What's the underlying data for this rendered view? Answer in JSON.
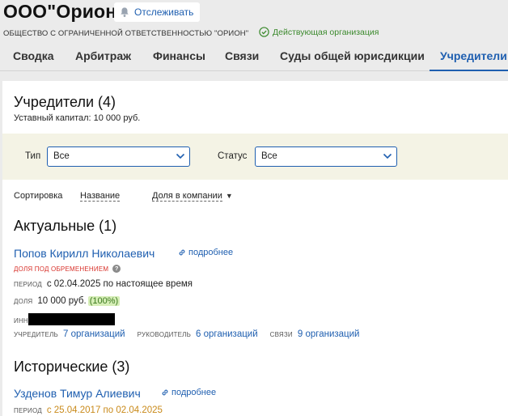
{
  "company": {
    "name": "ООО\"Орион\"",
    "watch_label": "Отслеживать",
    "full_name": "ОБЩЕСТВО С ОГРАНИЧЕННОЙ ОТВЕТСТВЕННОСТЬЮ \"ОРИОН\"",
    "status": "Действующая организация"
  },
  "tabs": [
    {
      "label": "Сводка",
      "active": false
    },
    {
      "label": "Арбитраж",
      "active": false
    },
    {
      "label": "Финансы",
      "active": false
    },
    {
      "label": "Связи",
      "active": false
    },
    {
      "label": "Суды общей юрисдикции",
      "active": false
    },
    {
      "label": "Учредители",
      "active": true
    }
  ],
  "founders": {
    "title": "Учредители (4)",
    "capital": "Уставный капитал: 10 000 руб.",
    "filters": {
      "type_label": "Тип",
      "type_value": "Все",
      "status_label": "Статус",
      "status_value": "Все"
    },
    "sort": {
      "label": "Сортировка",
      "by_name": "Название",
      "by_share": "Доля в компании"
    },
    "current": {
      "title": "Актуальные (1)",
      "person": {
        "name": "Попов Кирилл Николаевич",
        "more": "подробнее",
        "encumbrance": "ДОЛЯ ПОД ОБРЕМЕНЕНИЕМ",
        "period_label": "ПЕРИОД",
        "period": "с 02.04.2025 по настоящее время",
        "share_label": "ДОЛЯ",
        "share": "10 000 руб.",
        "share_pct": "(100%)",
        "inn_label": "ИНН",
        "founder_label": "УЧРЕДИТЕЛЬ",
        "founder_link": "7 организаций",
        "head_label": "РУКОВОДИТЕЛЬ",
        "head_link": "6 организаций",
        "ties_label": "СВЯЗИ",
        "ties_link": "9 организаций"
      }
    },
    "historic": {
      "title": "Исторические (3)",
      "person": {
        "name": "Узденов Тимур Алиевич",
        "more": "подробнее",
        "period_label": "ПЕРИОД",
        "period": "с 25.04.2017 по 02.04.2025"
      }
    }
  },
  "colors": {
    "accent": "#1f5fb0",
    "active_status": "#3c8a2e",
    "encumbrance": "#d8322b",
    "historic_period": "#c98a1a",
    "filter_bg": "#f4f3e5"
  }
}
